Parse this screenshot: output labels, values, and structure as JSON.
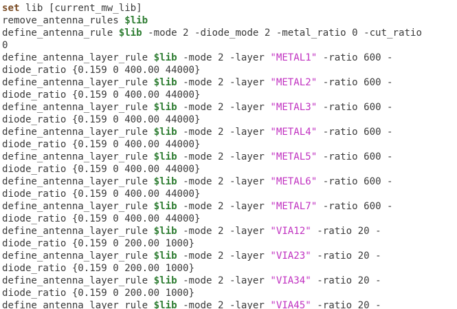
{
  "editor": {
    "lines": [
      [
        {
          "t": "kw",
          "v": "set"
        },
        {
          "t": "txt",
          "v": " lib [current_mw_lib]"
        }
      ],
      [
        {
          "t": "txt",
          "v": "remove_antenna_rules "
        },
        {
          "t": "var",
          "v": "$lib"
        }
      ],
      [
        {
          "t": "txt",
          "v": "define_antenna_rule "
        },
        {
          "t": "var",
          "v": "$lib"
        },
        {
          "t": "txt",
          "v": " -mode 2 -diode_mode 2 -metal_ratio 0 -cut_ratio"
        }
      ],
      [
        {
          "t": "txt",
          "v": "0"
        }
      ],
      [
        {
          "t": "txt",
          "v": "define_antenna_layer_rule "
        },
        {
          "t": "var",
          "v": "$lib"
        },
        {
          "t": "txt",
          "v": " -mode 2 -layer "
        },
        {
          "t": "str",
          "v": "\"METAL1\""
        },
        {
          "t": "txt",
          "v": " -ratio 600 -"
        }
      ],
      [
        {
          "t": "txt",
          "v": "diode_ratio {0.159 0 400.00 44000}"
        }
      ],
      [
        {
          "t": "txt",
          "v": "define_antenna_layer_rule "
        },
        {
          "t": "var",
          "v": "$lib"
        },
        {
          "t": "txt",
          "v": " -mode 2 -layer "
        },
        {
          "t": "str",
          "v": "\"METAL2\""
        },
        {
          "t": "txt",
          "v": " -ratio 600 -"
        }
      ],
      [
        {
          "t": "txt",
          "v": "diode_ratio {0.159 0 400.00 44000}"
        }
      ],
      [
        {
          "t": "txt",
          "v": "define_antenna_layer_rule "
        },
        {
          "t": "var",
          "v": "$lib"
        },
        {
          "t": "txt",
          "v": " -mode 2 -layer "
        },
        {
          "t": "str",
          "v": "\"METAL3\""
        },
        {
          "t": "txt",
          "v": " -ratio 600 -"
        }
      ],
      [
        {
          "t": "txt",
          "v": "diode_ratio {0.159 0 400.00 44000}"
        }
      ],
      [
        {
          "t": "txt",
          "v": "define_antenna_layer_rule "
        },
        {
          "t": "var",
          "v": "$lib"
        },
        {
          "t": "txt",
          "v": " -mode 2 -layer "
        },
        {
          "t": "str",
          "v": "\"METAL4\""
        },
        {
          "t": "txt",
          "v": " -ratio 600 -"
        }
      ],
      [
        {
          "t": "txt",
          "v": "diode_ratio {0.159 0 400.00 44000}"
        }
      ],
      [
        {
          "t": "txt",
          "v": "define_antenna_layer_rule "
        },
        {
          "t": "var",
          "v": "$lib"
        },
        {
          "t": "txt",
          "v": " -mode 2 -layer "
        },
        {
          "t": "str",
          "v": "\"METAL5\""
        },
        {
          "t": "txt",
          "v": " -ratio 600 -"
        }
      ],
      [
        {
          "t": "txt",
          "v": "diode_ratio {0.159 0 400.00 44000}"
        }
      ],
      [
        {
          "t": "txt",
          "v": "define_antenna_layer_rule "
        },
        {
          "t": "var",
          "v": "$lib"
        },
        {
          "t": "txt",
          "v": " -mode 2 -layer "
        },
        {
          "t": "str",
          "v": "\"METAL6\""
        },
        {
          "t": "txt",
          "v": " -ratio 600 -"
        }
      ],
      [
        {
          "t": "txt",
          "v": "diode_ratio {0.159 0 400.00 44000}"
        }
      ],
      [
        {
          "t": "txt",
          "v": "define_antenna_layer_rule "
        },
        {
          "t": "var",
          "v": "$lib"
        },
        {
          "t": "txt",
          "v": " -mode 2 -layer "
        },
        {
          "t": "str",
          "v": "\"METAL7\""
        },
        {
          "t": "txt",
          "v": " -ratio 600 -"
        }
      ],
      [
        {
          "t": "txt",
          "v": "diode_ratio {0.159 0 400.00 44000}"
        }
      ],
      [
        {
          "t": "txt",
          "v": "define_antenna_layer_rule "
        },
        {
          "t": "var",
          "v": "$lib"
        },
        {
          "t": "txt",
          "v": " -mode 2 -layer "
        },
        {
          "t": "str",
          "v": "\"VIA12\""
        },
        {
          "t": "txt",
          "v": " -ratio 20 -"
        }
      ],
      [
        {
          "t": "txt",
          "v": "diode_ratio {0.159 0 200.00 1000}"
        }
      ],
      [
        {
          "t": "txt",
          "v": "define_antenna_layer_rule "
        },
        {
          "t": "var",
          "v": "$lib"
        },
        {
          "t": "txt",
          "v": " -mode 2 -layer "
        },
        {
          "t": "str",
          "v": "\"VIA23\""
        },
        {
          "t": "txt",
          "v": " -ratio 20 -"
        }
      ],
      [
        {
          "t": "txt",
          "v": "diode_ratio {0.159 0 200.00 1000}"
        }
      ],
      [
        {
          "t": "txt",
          "v": "define_antenna_layer_rule "
        },
        {
          "t": "var",
          "v": "$lib"
        },
        {
          "t": "txt",
          "v": " -mode 2 -layer "
        },
        {
          "t": "str",
          "v": "\"VIA34\""
        },
        {
          "t": "txt",
          "v": " -ratio 20 -"
        }
      ],
      [
        {
          "t": "txt",
          "v": "diode_ratio {0.159 0 200.00 1000}"
        }
      ],
      [
        {
          "t": "txt",
          "v": "define_antenna_layer_rule "
        },
        {
          "t": "var",
          "v": "$lib"
        },
        {
          "t": "txt",
          "v": " -mode 2 -layer "
        },
        {
          "t": "str",
          "v": "\"VIA45\""
        },
        {
          "t": "txt",
          "v": " -ratio 20 -"
        }
      ]
    ]
  },
  "colors": {
    "background": "#ffffff",
    "text": "#3a3a3a",
    "keyword": "#7a4b24",
    "variable": "#2e7d32",
    "string": "#c030c0"
  }
}
